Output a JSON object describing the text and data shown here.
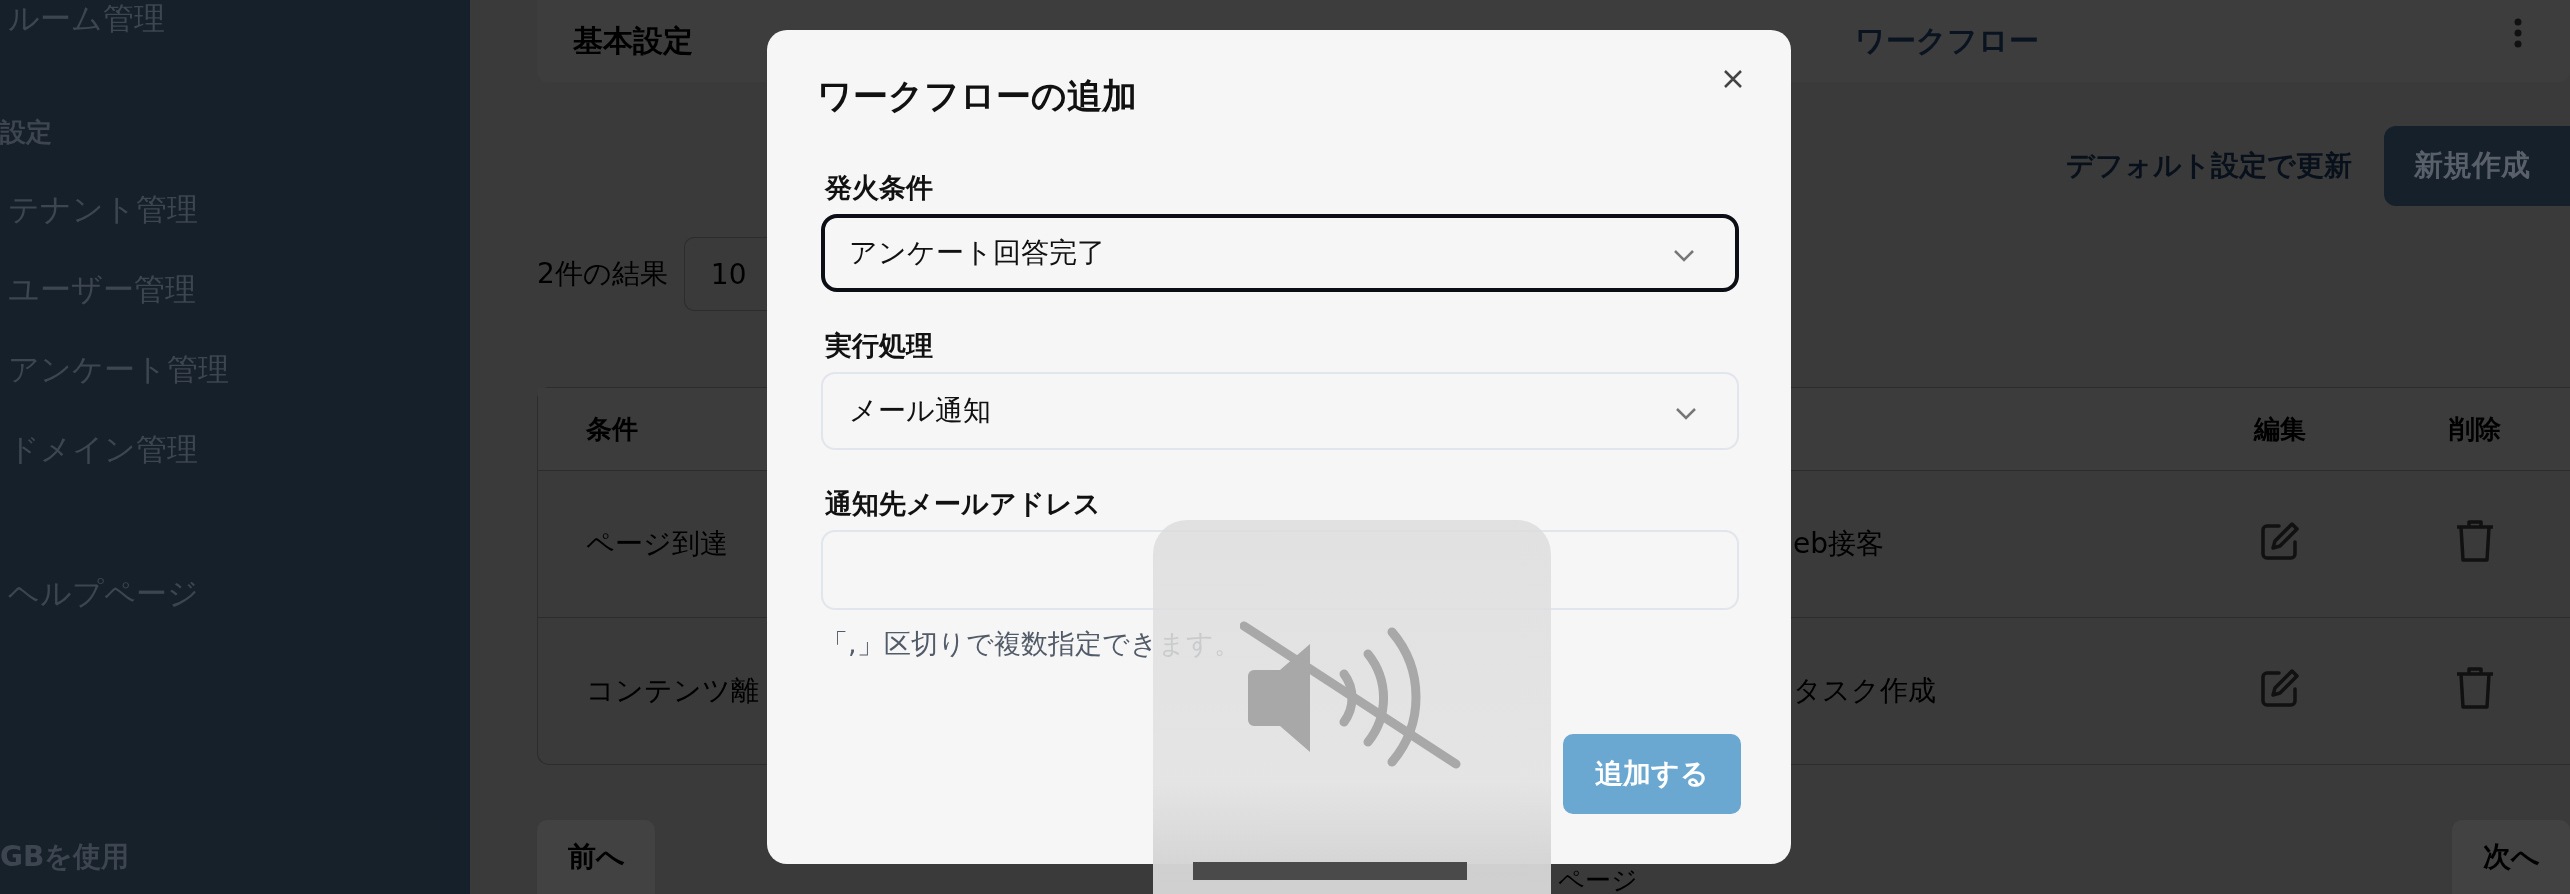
{
  "sidebar": {
    "items": [
      {
        "label": "ルーム管理",
        "kind": "item"
      },
      {
        "label": "設定",
        "kind": "heading"
      },
      {
        "label": "テナント管理",
        "kind": "item"
      },
      {
        "label": "ユーザー管理",
        "kind": "item"
      },
      {
        "label": "アンケート管理",
        "kind": "item"
      },
      {
        "label": "ドメイン管理",
        "kind": "item"
      },
      {
        "label": "ヘルプページ",
        "kind": "item"
      }
    ],
    "storage": "GBを使用"
  },
  "tabs": [
    {
      "label": "基本設定",
      "selected": false
    },
    {
      "label": "ワークフロー",
      "selected": true
    }
  ],
  "actions": {
    "reset_link": "デフォルト設定で更新",
    "new_button": "新規作成"
  },
  "results": {
    "count": "2件の結果",
    "page_size": "10"
  },
  "table": {
    "columns": [
      "条件",
      "編集",
      "削除"
    ],
    "rows": [
      {
        "condition": "ページ到達",
        "column_2": "eb接客"
      },
      {
        "condition": "コンテンツ離",
        "column_2": "タスク作成"
      }
    ]
  },
  "pager": {
    "prev": "前へ",
    "page": "ページ",
    "next": "次へ"
  },
  "dialog": {
    "title": "ワークフローの追加",
    "fields": [
      {
        "label": "発火条件",
        "kind": "select",
        "value": "アンケート回答完了",
        "focused": true
      },
      {
        "label": "実行処理",
        "kind": "select",
        "value": "メール通知",
        "focused": false
      },
      {
        "label": "通知先メールアドレス",
        "kind": "text",
        "hint": "「,」区切りで複数指定できます。"
      }
    ],
    "submit": "追加する"
  },
  "volume_overlay": {
    "muted": true
  }
}
